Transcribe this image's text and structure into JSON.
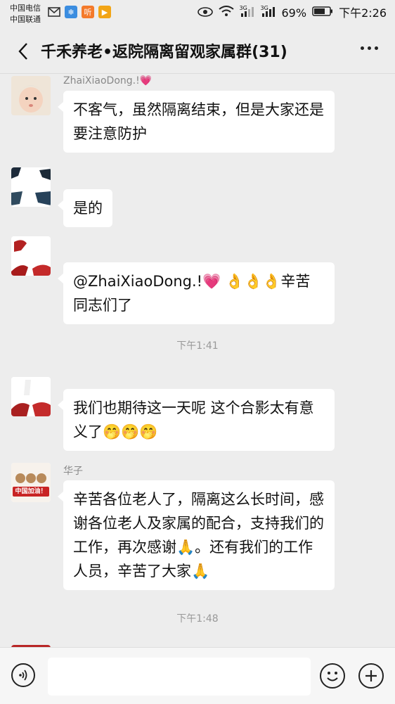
{
  "status_bar": {
    "carrier_1": "中国电信",
    "carrier_2": "中国联通",
    "network_1": "3G",
    "network_2": "3G",
    "battery": "69%",
    "time": "下午2:26"
  },
  "header": {
    "title": "千禾养老•返院隔离留观家属群(31)"
  },
  "messages": [
    {
      "sender": "ZhaiXiaoDong.!💗",
      "text": "不客气，虽然隔离结束，但是大家还是要注意防护"
    },
    {
      "sender": "",
      "text": "是的"
    },
    {
      "sender": "",
      "text": "@ZhaiXiaoDong.!💗 👌👌👌辛苦同志们了"
    },
    {
      "sender": "",
      "text": "我们也期待这一天呢 这个合影太有意义了🤭🤭🤭"
    },
    {
      "sender": "华子",
      "text": "辛苦各位老人了，隔离这么长时间，感谢各位老人及家属的配合，支持我们的工作，再次感谢🙏。还有我们的工作人员，辛苦了大家🙏"
    }
  ],
  "avatar_badge_text": "中国加油！",
  "timestamps": [
    "下午1:41",
    "下午1:48"
  ],
  "input": {
    "placeholder": ""
  }
}
